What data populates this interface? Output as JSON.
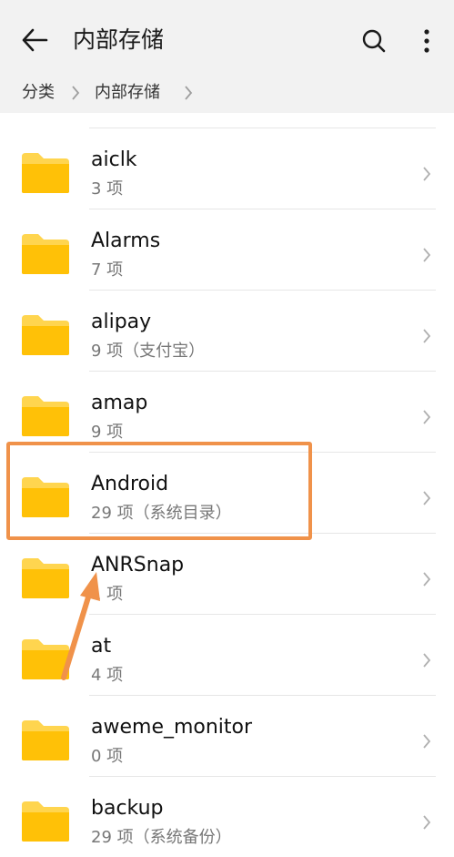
{
  "header": {
    "title": "内部存储",
    "back_icon": "arrow-left-icon",
    "search_icon": "search-icon",
    "more_icon": "more-vertical-icon"
  },
  "breadcrumb": {
    "items": [
      "分类",
      "内部存储"
    ]
  },
  "folders": [
    {
      "name": "aiclk",
      "info": "3 项"
    },
    {
      "name": "Alarms",
      "info": "7 项"
    },
    {
      "name": "alipay",
      "info": "9 项（支付宝）"
    },
    {
      "name": "amap",
      "info": "9 项"
    },
    {
      "name": "Android",
      "info": "29 项（系统目录）"
    },
    {
      "name": "ANRSnap",
      "info": "1 项"
    },
    {
      "name": "at",
      "info": "4 项"
    },
    {
      "name": "aweme_monitor",
      "info": "0 项"
    },
    {
      "name": "backup",
      "info": "29 项（系统备份）"
    }
  ],
  "colors": {
    "folder": "#ffc107",
    "folder_tab": "#ffd54f",
    "annotation": "#f0924a"
  }
}
